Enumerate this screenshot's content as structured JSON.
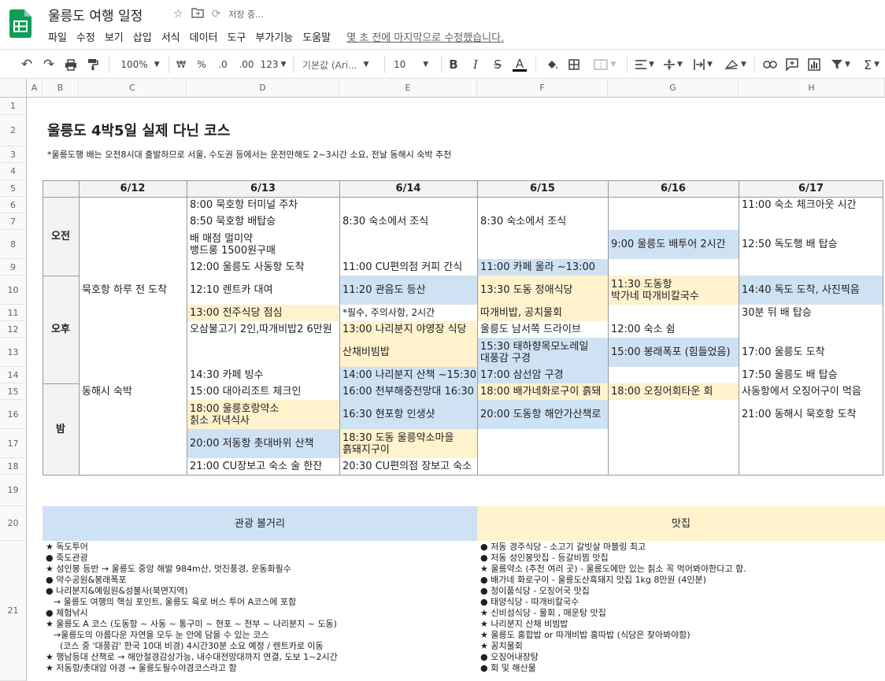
{
  "header": {
    "doc_title": "울릉도 여행 일정",
    "save_status": "저장 중...",
    "menu": [
      "파일",
      "수정",
      "보기",
      "삽입",
      "서식",
      "데이터",
      "도구",
      "부가기능",
      "도움말"
    ],
    "last_edit": "몇 초 전에 마지막으로 수정했습니다."
  },
  "toolbar": {
    "zoom": "100%",
    "currency": "₩",
    "percent": "%",
    "dec_less": ".0",
    "dec_more": ".00",
    "format_more": "123",
    "font": "기본값 (Ari...",
    "font_size": "10"
  },
  "columns": [
    "A",
    "B",
    "C",
    "D",
    "E",
    "F",
    "G",
    "H"
  ],
  "rows": [
    "1",
    "2",
    "3",
    "4",
    "5",
    "6",
    "7",
    "8",
    "9",
    "10",
    "11",
    "12",
    "13",
    "14",
    "15",
    "16",
    "17",
    "18",
    "19",
    "20",
    "21"
  ],
  "sheet": {
    "title": "울릉도 4박5일 실제 다닌 코스",
    "note": "*울릉도행 배는 오전8시대 출발하므로 서울, 수도권 등에서는 운전만해도 2~3시간 소요, 전날 동해시 숙박 추천",
    "dates": [
      "6/12",
      "6/13",
      "6/14",
      "6/15",
      "6/16",
      "6/17"
    ],
    "periods": [
      "오전",
      "오후",
      "밤"
    ],
    "c612_afternoon": "묵호항 하루 전 도착",
    "c612_night": "동해시 숙박",
    "d613": [
      "8:00 묵호항 터미널 주차",
      "8:50 묵호항 배탑승",
      "배 매점 멀미약",
      "뱅드롱 1500원구매",
      "12:00 울릉도 사동항 도착",
      "12:10 렌트카 대여",
      "13:00 전주식당 점심",
      "오삼불고기 2인,따개비밥2 6만원",
      "14:30 카페 빙수",
      "15:00 대아리조트 체크인",
      "18:00 울릉호랑약소",
      "칡소 저녁식사",
      "20:00 저동항 촛대바위 산책",
      "21:00 CU장보고 숙소 술 한잔"
    ],
    "e614": [
      "8:30 숙소에서 조식",
      "11:00 CU편의점 커피 간식",
      "11:20 관음도 등산",
      "*필수, 주의사항, 2시간",
      "13:00 나리분지 야영장 식당",
      "산채비빔밥",
      "14:00 나리분지 산책 ~15:30",
      "16:00 천부해중전망대 16:30",
      "16:30 현포항 인생샷",
      "18:30 도동 울릉약소마을",
      "흙돼지구이",
      "20:30 CU편의점 장보고 숙소"
    ],
    "f615": [
      "8:30 숙소에서 조식",
      "11:00 카페 울라 ~13:00",
      "13:30 도동 정애식당",
      "따개비밥, 공치물회",
      "울릉도 남서쪽 드라이브",
      "15:30 태하향목모노레일",
      "대풍감 구경",
      "17:00 삼선암 구경",
      "18:00 배가네화로구이 흙돼",
      "20:00 도동항 해안가산책로"
    ],
    "g616": [
      "9:00 울릉도 배투어 2시간",
      "11:30 도동항",
      "박가네 따개비칼국수",
      "12:00 숙소 쉼",
      "15:00 봉래폭포 (힘들었음)",
      "18:00 오징어회타운 회"
    ],
    "h617": [
      "11:00 숙소 체크아웃 시간",
      "12:50 독도행 배 탑승",
      "14:40 독도 도착, 사진찍음",
      "30분 뒤 배 탑승",
      "17:00 울릉도 도착",
      "17:50 울릉도 배 탑승",
      "사동항에서 오징어구이 먹음",
      "21:00 동해시 묵호항 도착"
    ],
    "sights_header": "관광 볼거리",
    "food_header": "맛집",
    "sights": [
      "★ 독도투어",
      "● 죽도관광",
      "★ 성인봉 등반 → 울릉도 중앙 해발 984m산, 멋진풍경, 운동화필수",
      "● 약수공원&봉래폭포",
      "● 나리분지&예림원&성불사(북면지역)",
      "→ 울릉도 여행의 핵심 포인트, 울릉도 육로 버스 투어 A코스에 포함",
      "● 체험낚시",
      "★ 울릉도 A 코스 (도동항 ~ 사동 ~ 통구미 ~ 현포 ~ 천부 ~ 나리분지 ~ 도동)",
      "→울릉도의 아름다운 자연을 모두 눈 안에 담을 수 있는 코스",
      "(코스 중 '대풍감' 한국 10대 비경) 4시간30분 소요 예정 / 렌트카로 이동",
      "★ 행남등대 산책로 → 해안절경감상가능, 내수대전망대까지 연결, 도보 1~2시간",
      "★ 저동항/촛대암 야경 → 울릉도필수야경코스라고 함"
    ],
    "food": [
      "● 저동 경주식당 - 소고기 갈빗살 마블링 최고",
      "● 저동 성인봉맛집 - 등갈비찜 맛집",
      "★ 울릉약소 (추천 여러 곳) - 울릉도에만 있는 칡소 꼭 먹어봐야한다고 함.",
      "● 배가네 화로구이 - 울릉도산흑돼지 맛집 1kg 8만원 (4인분)",
      "● 정이품식당 - 오징어국 맛집",
      "● 태양식당 - 따개비칼국수",
      "★ 신비섬식당 - 물회 , 매운탕 맛집",
      "★ 나리분지 산채 비빔밥",
      "★ 울릉도 홍합밥 or 따개비밥 홍따밥 (식당은 찾아봐야함)",
      "★ 꽁치물회",
      "● 오징어내장탕",
      "● 회 및 해산물"
    ]
  },
  "colors": {
    "blue": "#cfe2f3",
    "yellow": "#fff2cc",
    "sheets_green": "#0f9d58"
  }
}
